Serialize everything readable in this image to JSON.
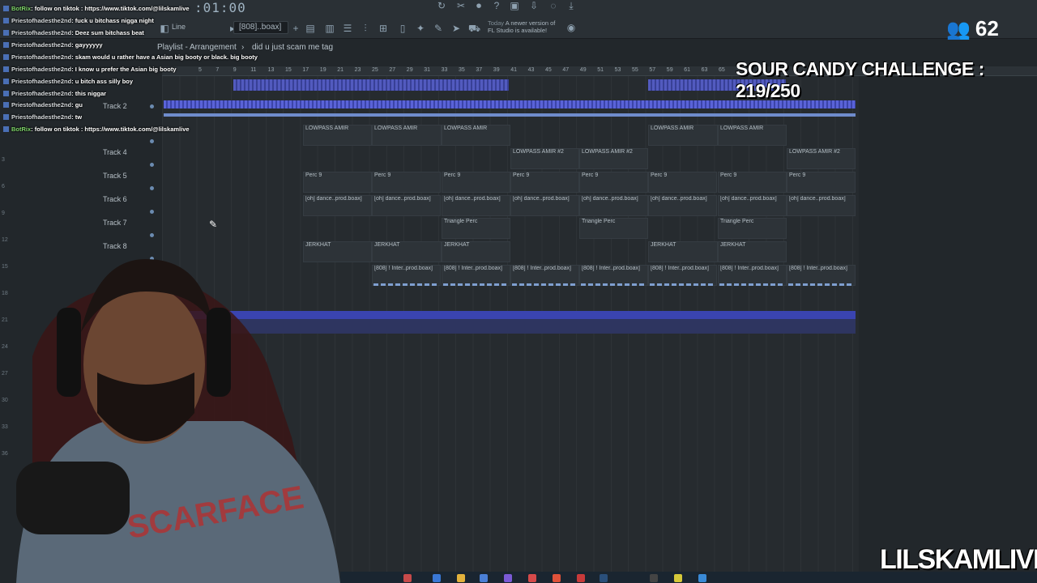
{
  "toolbar": {
    "time": ":01:00",
    "pattern": "[808]..boax]",
    "snap": "Line",
    "news_label": "Today",
    "news_text_1": "A newer version of",
    "news_text_2": "FL Studio is available!"
  },
  "playlist": {
    "title": "Playlist - Arrangement",
    "path_sep": "›",
    "arrangement_name": "did u just scam me tag"
  },
  "ruler": [
    "5",
    "7",
    "9",
    "11",
    "13",
    "15",
    "17",
    "19",
    "21",
    "23",
    "25",
    "27",
    "29",
    "31",
    "33",
    "35",
    "37",
    "39",
    "41",
    "43",
    "45",
    "47",
    "49",
    "51",
    "53",
    "55",
    "57",
    "59",
    "61",
    "63",
    "65"
  ],
  "tracks": [
    {
      "label": "Track 2"
    },
    {
      "label": "Track 4"
    },
    {
      "label": "Track 5"
    },
    {
      "label": "Track 6"
    },
    {
      "label": "Track 7"
    },
    {
      "label": "Track 8"
    }
  ],
  "left_ticks": [
    "3",
    "6",
    "9",
    "12",
    "15",
    "18",
    "21",
    "24",
    "27",
    "30",
    "33",
    "36"
  ],
  "clips": {
    "lowpass": "LOWPASS AMIR",
    "lowpass2": "LOWPASS AMIR #2",
    "perc": "Perc 9",
    "dance": "[oh] dance..prod.boax]",
    "triangle": "Triangle Perc",
    "jerkhat": "JERKHAT",
    "inter": "[808] ! Inter..prod.boax]"
  },
  "chat": [
    {
      "user": "BotRix",
      "bot": true,
      "msg": ": follow on tiktok : https://www.tiktok.com/@lilskamlive"
    },
    {
      "user": "Priestofhadesthe2nd",
      "bot": false,
      "msg": ": fuck u bitchass nigga night"
    },
    {
      "user": "Priestofhadesthe2nd",
      "bot": false,
      "msg": ": Deez sum bitchass beat"
    },
    {
      "user": "Priestofhadesthe2nd",
      "bot": false,
      "msg": ": gayyyyyy"
    },
    {
      "user": "Priestofhadesthe2nd",
      "bot": false,
      "msg": ": skam would u rather have a Asian big booty or black. big booty"
    },
    {
      "user": "Priestofhadesthe2nd",
      "bot": false,
      "msg": ": I know u prefer the Asian big booty"
    },
    {
      "user": "Priestofhadesthe2nd",
      "bot": false,
      "msg": ": u bitch ass silly boy"
    },
    {
      "user": "Priestofhadesthe2nd",
      "bot": false,
      "msg": ": this niggar"
    },
    {
      "user": "Priestofhadesthe2nd",
      "bot": false,
      "msg": ": gu"
    },
    {
      "user": "Priestofhadesthe2nd",
      "bot": false,
      "msg": ": tw"
    },
    {
      "user": "BotRix",
      "bot": true,
      "msg": ": follow on tiktok : https://www.tiktok.com/@lilskamlive"
    }
  ],
  "overlay": {
    "viewer_count": "62",
    "challenge": "SOUR CANDY CHALLENGE : 219/250",
    "channel": "LILSKAMLIVE"
  },
  "colors": {
    "accent_blue": "#5a63d8",
    "bot_green": "#7fd66a"
  }
}
